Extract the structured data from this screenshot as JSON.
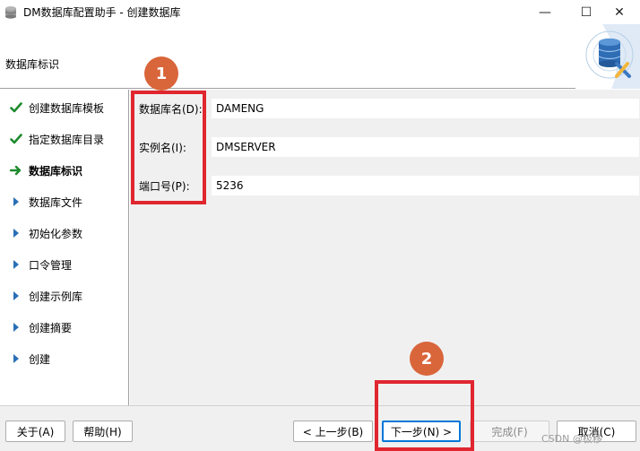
{
  "window": {
    "title": "DM数据库配置助手 - 创建数据库",
    "controls": {
      "minimize": "—",
      "maximize": "☐",
      "close": "✕"
    }
  },
  "header": {
    "section_label": "数据库标识"
  },
  "steps": [
    {
      "label": "创建数据库模板",
      "status": "done"
    },
    {
      "label": "指定数据库目录",
      "status": "done"
    },
    {
      "label": "数据库标识",
      "status": "current"
    },
    {
      "label": "数据库文件",
      "status": "pending"
    },
    {
      "label": "初始化参数",
      "status": "pending"
    },
    {
      "label": "口令管理",
      "status": "pending"
    },
    {
      "label": "创建示例库",
      "status": "pending"
    },
    {
      "label": "创建摘要",
      "status": "pending"
    },
    {
      "label": "创建",
      "status": "pending"
    }
  ],
  "form": {
    "db_name": {
      "label": "数据库名(D):",
      "value": "DAMENG"
    },
    "instance_name": {
      "label": "实例名(I):",
      "value": "DMSERVER"
    },
    "port": {
      "label": "端口号(P):",
      "value": "5236"
    }
  },
  "buttons": {
    "about": "关于(A)",
    "help": "帮助(H)",
    "prev": "< 上一步(B)",
    "next": "下一步(N) >",
    "finish": "完成(F)",
    "cancel": "取消(C)"
  },
  "annotations": {
    "badge1": "1",
    "badge2": "2"
  },
  "watermark": "CSDN @极移",
  "colors": {
    "check": "#1e8a2e",
    "arrow": "#1e8a2e",
    "pending": "#2a6fb5",
    "annotation_red": "#e0262f",
    "badge": "#d9653b",
    "primary_border": "#0078d7"
  }
}
